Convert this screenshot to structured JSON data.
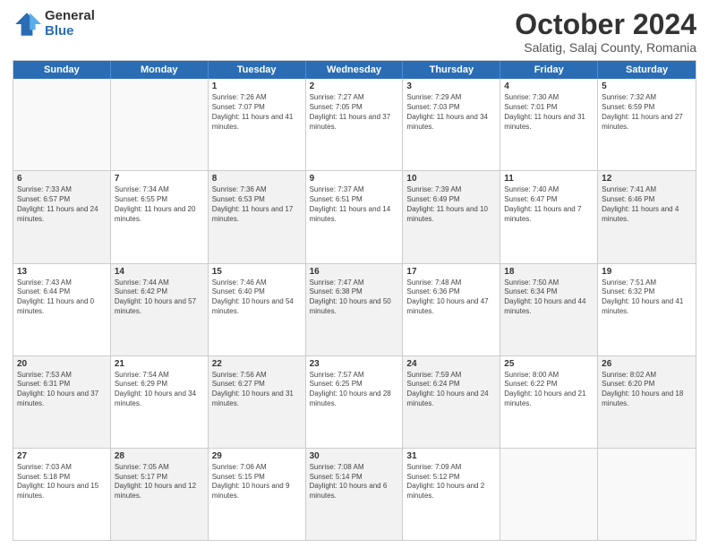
{
  "header": {
    "logo_general": "General",
    "logo_blue": "Blue",
    "month_title": "October 2024",
    "location": "Salatig, Salaj County, Romania"
  },
  "days_of_week": [
    "Sunday",
    "Monday",
    "Tuesday",
    "Wednesday",
    "Thursday",
    "Friday",
    "Saturday"
  ],
  "weeks": [
    [
      {
        "day": "",
        "empty": true
      },
      {
        "day": "",
        "empty": true
      },
      {
        "day": "1",
        "sunrise": "Sunrise: 7:26 AM",
        "sunset": "Sunset: 7:07 PM",
        "daylight": "Daylight: 11 hours and 41 minutes."
      },
      {
        "day": "2",
        "sunrise": "Sunrise: 7:27 AM",
        "sunset": "Sunset: 7:05 PM",
        "daylight": "Daylight: 11 hours and 37 minutes."
      },
      {
        "day": "3",
        "sunrise": "Sunrise: 7:29 AM",
        "sunset": "Sunset: 7:03 PM",
        "daylight": "Daylight: 11 hours and 34 minutes."
      },
      {
        "day": "4",
        "sunrise": "Sunrise: 7:30 AM",
        "sunset": "Sunset: 7:01 PM",
        "daylight": "Daylight: 11 hours and 31 minutes."
      },
      {
        "day": "5",
        "sunrise": "Sunrise: 7:32 AM",
        "sunset": "Sunset: 6:59 PM",
        "daylight": "Daylight: 11 hours and 27 minutes."
      }
    ],
    [
      {
        "day": "6",
        "sunrise": "Sunrise: 7:33 AM",
        "sunset": "Sunset: 6:57 PM",
        "daylight": "Daylight: 11 hours and 24 minutes.",
        "shaded": true
      },
      {
        "day": "7",
        "sunrise": "Sunrise: 7:34 AM",
        "sunset": "Sunset: 6:55 PM",
        "daylight": "Daylight: 11 hours and 20 minutes."
      },
      {
        "day": "8",
        "sunrise": "Sunrise: 7:36 AM",
        "sunset": "Sunset: 6:53 PM",
        "daylight": "Daylight: 11 hours and 17 minutes.",
        "shaded": true
      },
      {
        "day": "9",
        "sunrise": "Sunrise: 7:37 AM",
        "sunset": "Sunset: 6:51 PM",
        "daylight": "Daylight: 11 hours and 14 minutes."
      },
      {
        "day": "10",
        "sunrise": "Sunrise: 7:39 AM",
        "sunset": "Sunset: 6:49 PM",
        "daylight": "Daylight: 11 hours and 10 minutes.",
        "shaded": true
      },
      {
        "day": "11",
        "sunrise": "Sunrise: 7:40 AM",
        "sunset": "Sunset: 6:47 PM",
        "daylight": "Daylight: 11 hours and 7 minutes."
      },
      {
        "day": "12",
        "sunrise": "Sunrise: 7:41 AM",
        "sunset": "Sunset: 6:46 PM",
        "daylight": "Daylight: 11 hours and 4 minutes.",
        "shaded": true
      }
    ],
    [
      {
        "day": "13",
        "sunrise": "Sunrise: 7:43 AM",
        "sunset": "Sunset: 6:44 PM",
        "daylight": "Daylight: 11 hours and 0 minutes."
      },
      {
        "day": "14",
        "sunrise": "Sunrise: 7:44 AM",
        "sunset": "Sunset: 6:42 PM",
        "daylight": "Daylight: 10 hours and 57 minutes.",
        "shaded": true
      },
      {
        "day": "15",
        "sunrise": "Sunrise: 7:46 AM",
        "sunset": "Sunset: 6:40 PM",
        "daylight": "Daylight: 10 hours and 54 minutes."
      },
      {
        "day": "16",
        "sunrise": "Sunrise: 7:47 AM",
        "sunset": "Sunset: 6:38 PM",
        "daylight": "Daylight: 10 hours and 50 minutes.",
        "shaded": true
      },
      {
        "day": "17",
        "sunrise": "Sunrise: 7:48 AM",
        "sunset": "Sunset: 6:36 PM",
        "daylight": "Daylight: 10 hours and 47 minutes."
      },
      {
        "day": "18",
        "sunrise": "Sunrise: 7:50 AM",
        "sunset": "Sunset: 6:34 PM",
        "daylight": "Daylight: 10 hours and 44 minutes.",
        "shaded": true
      },
      {
        "day": "19",
        "sunrise": "Sunrise: 7:51 AM",
        "sunset": "Sunset: 6:32 PM",
        "daylight": "Daylight: 10 hours and 41 minutes."
      }
    ],
    [
      {
        "day": "20",
        "sunrise": "Sunrise: 7:53 AM",
        "sunset": "Sunset: 6:31 PM",
        "daylight": "Daylight: 10 hours and 37 minutes.",
        "shaded": true
      },
      {
        "day": "21",
        "sunrise": "Sunrise: 7:54 AM",
        "sunset": "Sunset: 6:29 PM",
        "daylight": "Daylight: 10 hours and 34 minutes."
      },
      {
        "day": "22",
        "sunrise": "Sunrise: 7:56 AM",
        "sunset": "Sunset: 6:27 PM",
        "daylight": "Daylight: 10 hours and 31 minutes.",
        "shaded": true
      },
      {
        "day": "23",
        "sunrise": "Sunrise: 7:57 AM",
        "sunset": "Sunset: 6:25 PM",
        "daylight": "Daylight: 10 hours and 28 minutes."
      },
      {
        "day": "24",
        "sunrise": "Sunrise: 7:59 AM",
        "sunset": "Sunset: 6:24 PM",
        "daylight": "Daylight: 10 hours and 24 minutes.",
        "shaded": true
      },
      {
        "day": "25",
        "sunrise": "Sunrise: 8:00 AM",
        "sunset": "Sunset: 6:22 PM",
        "daylight": "Daylight: 10 hours and 21 minutes."
      },
      {
        "day": "26",
        "sunrise": "Sunrise: 8:02 AM",
        "sunset": "Sunset: 6:20 PM",
        "daylight": "Daylight: 10 hours and 18 minutes.",
        "shaded": true
      }
    ],
    [
      {
        "day": "27",
        "sunrise": "Sunrise: 7:03 AM",
        "sunset": "Sunset: 5:18 PM",
        "daylight": "Daylight: 10 hours and 15 minutes."
      },
      {
        "day": "28",
        "sunrise": "Sunrise: 7:05 AM",
        "sunset": "Sunset: 5:17 PM",
        "daylight": "Daylight: 10 hours and 12 minutes.",
        "shaded": true
      },
      {
        "day": "29",
        "sunrise": "Sunrise: 7:06 AM",
        "sunset": "Sunset: 5:15 PM",
        "daylight": "Daylight: 10 hours and 9 minutes."
      },
      {
        "day": "30",
        "sunrise": "Sunrise: 7:08 AM",
        "sunset": "Sunset: 5:14 PM",
        "daylight": "Daylight: 10 hours and 6 minutes.",
        "shaded": true
      },
      {
        "day": "31",
        "sunrise": "Sunrise: 7:09 AM",
        "sunset": "Sunset: 5:12 PM",
        "daylight": "Daylight: 10 hours and 2 minutes."
      },
      {
        "day": "",
        "empty": true
      },
      {
        "day": "",
        "empty": true
      }
    ]
  ]
}
